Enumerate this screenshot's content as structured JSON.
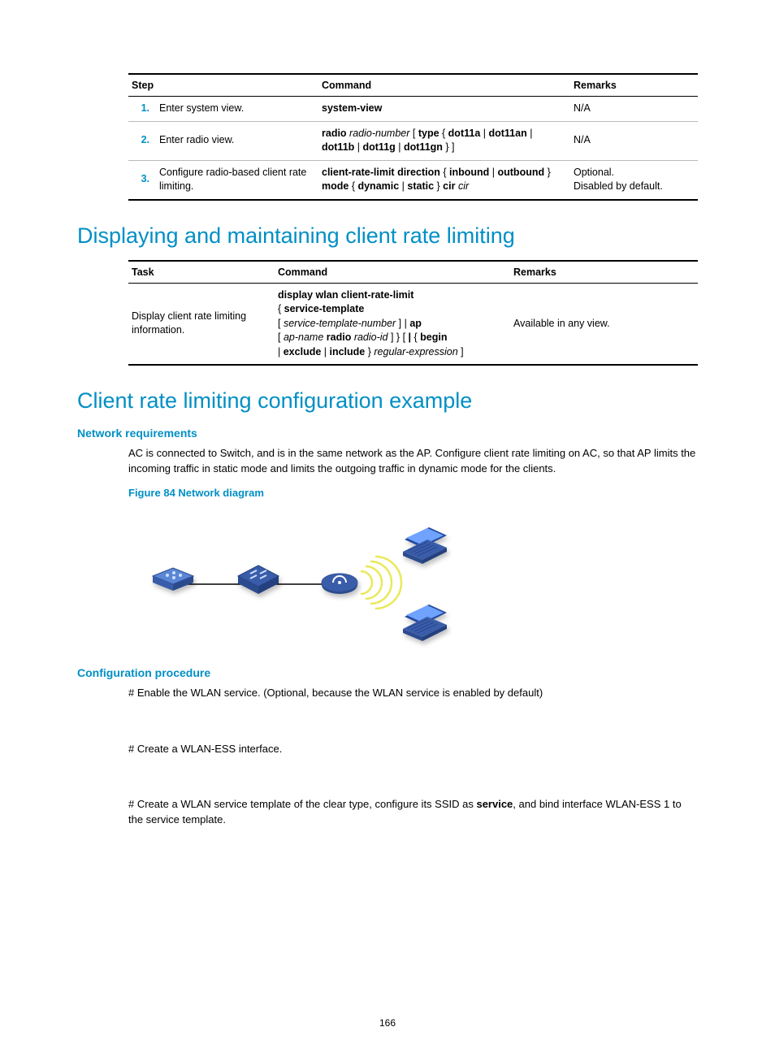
{
  "table1": {
    "headers": {
      "step": "Step",
      "command": "Command",
      "remarks": "Remarks"
    },
    "rows": [
      {
        "num": "1.",
        "step": "Enter system view.",
        "cmd_segments": [
          {
            "t": "system-view",
            "b": true
          }
        ],
        "remarks": "N/A"
      },
      {
        "num": "2.",
        "step": "Enter radio view.",
        "cmd_segments": [
          {
            "t": "radio ",
            "b": true
          },
          {
            "t": "radio-number ",
            "i": true
          },
          {
            "t": "[ "
          },
          {
            "t": "type ",
            "b": true
          },
          {
            "t": "{ "
          },
          {
            "t": "dot11a",
            "b": true
          },
          {
            "t": " | "
          },
          {
            "t": "dot11an",
            "b": true
          },
          {
            "t": " | "
          },
          {
            "t": "dot11b",
            "b": true
          },
          {
            "t": " | "
          },
          {
            "t": "dot11g",
            "b": true
          },
          {
            "t": " | "
          },
          {
            "t": "dot11gn",
            "b": true
          },
          {
            "t": " } ]"
          }
        ],
        "remarks": "N/A"
      },
      {
        "num": "3.",
        "step": "Configure radio-based client rate limiting.",
        "cmd_segments": [
          {
            "t": "client-rate-limit direction ",
            "b": true
          },
          {
            "t": "{ "
          },
          {
            "t": "inbound",
            "b": true
          },
          {
            "t": " | "
          },
          {
            "t": "outbound",
            "b": true
          },
          {
            "t": " } "
          },
          {
            "t": "mode ",
            "b": true
          },
          {
            "t": "{ "
          },
          {
            "t": "dynamic",
            "b": true
          },
          {
            "t": " | "
          },
          {
            "t": "static",
            "b": true
          },
          {
            "t": " } "
          },
          {
            "t": "cir ",
            "b": true
          },
          {
            "t": "cir",
            "i": true
          }
        ],
        "remarks": "Optional.\nDisabled by default."
      }
    ]
  },
  "h1_display": "Displaying and maintaining client rate limiting",
  "table2": {
    "headers": {
      "task": "Task",
      "command": "Command",
      "remarks": "Remarks"
    },
    "row": {
      "task": "Display client rate limiting information.",
      "cmd_segments": [
        {
          "t": "display wlan client-rate-limit",
          "b": true
        },
        {
          "t": "\n"
        },
        {
          "t": "{ "
        },
        {
          "t": "service-template",
          "b": true
        },
        {
          "t": "\n"
        },
        {
          "t": "[ "
        },
        {
          "t": "service-template-number",
          "i": true
        },
        {
          "t": " ] | "
        },
        {
          "t": "ap",
          "b": true
        },
        {
          "t": "\n"
        },
        {
          "t": "[ "
        },
        {
          "t": "ap-name ",
          "i": true
        },
        {
          "t": "radio ",
          "b": true
        },
        {
          "t": "radio-id",
          "i": true
        },
        {
          "t": " ] } [ "
        },
        {
          "t": "|",
          "b": true
        },
        {
          "t": " { "
        },
        {
          "t": "begin",
          "b": true
        },
        {
          "t": "\n"
        },
        {
          "t": "| "
        },
        {
          "t": "exclude",
          "b": true
        },
        {
          "t": " | "
        },
        {
          "t": "include",
          "b": true
        },
        {
          "t": " }\n"
        },
        {
          "t": "regular-expression",
          "i": true
        },
        {
          "t": " ]"
        }
      ],
      "remarks": "Available in any view."
    }
  },
  "h1_example": "Client rate limiting configuration example",
  "netreq": {
    "title": "Network requirements",
    "para": "AC is connected to Switch, and is in the same network as the AP. Configure client rate limiting on AC, so that AP limits the incoming traffic in static mode and limits the outgoing traffic in dynamic mode for the clients."
  },
  "fig84": "Figure 84 Network diagram",
  "confproc": {
    "title": "Configuration procedure",
    "p1": "# Enable the WLAN service. (Optional, because the WLAN service is enabled by default)",
    "p2": "# Create a WLAN-ESS interface.",
    "p3_segments": [
      {
        "t": "# Create a WLAN service template of the clear type, configure its SSID as "
      },
      {
        "t": "service",
        "b": true
      },
      {
        "t": ", and bind interface WLAN-ESS 1 to the service template."
      }
    ]
  },
  "pagenum": "166"
}
